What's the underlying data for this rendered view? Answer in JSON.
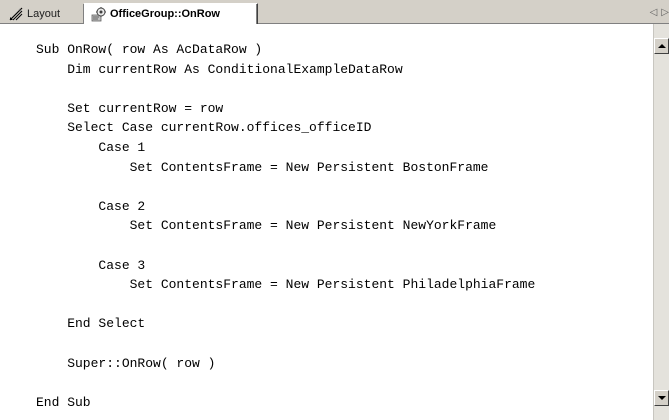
{
  "tabs": {
    "layout_label": "Layout",
    "layout_icon": "layout-pencil-icon",
    "active_label": "OfficeGroup::OnRow",
    "active_icon": "method-gear-icon",
    "prev_arrow": "◁",
    "next_arrow": "▷"
  },
  "code_lines": [
    "Sub OnRow( row As AcDataRow )",
    "    Dim currentRow As ConditionalExampleDataRow",
    "",
    "    Set currentRow = row",
    "    Select Case currentRow.offices_officeID",
    "        Case 1",
    "            Set ContentsFrame = New Persistent BostonFrame",
    "",
    "        Case 2",
    "            Set ContentsFrame = New Persistent NewYorkFrame",
    "",
    "        Case 3",
    "            Set ContentsFrame = New Persistent PhiladelphiaFrame",
    "",
    "    End Select",
    "",
    "    Super::OnRow( row )",
    "",
    "End Sub"
  ],
  "colors": {
    "chrome": "#d4d0c8",
    "editor_bg": "#ffffff",
    "text": "#000000"
  }
}
